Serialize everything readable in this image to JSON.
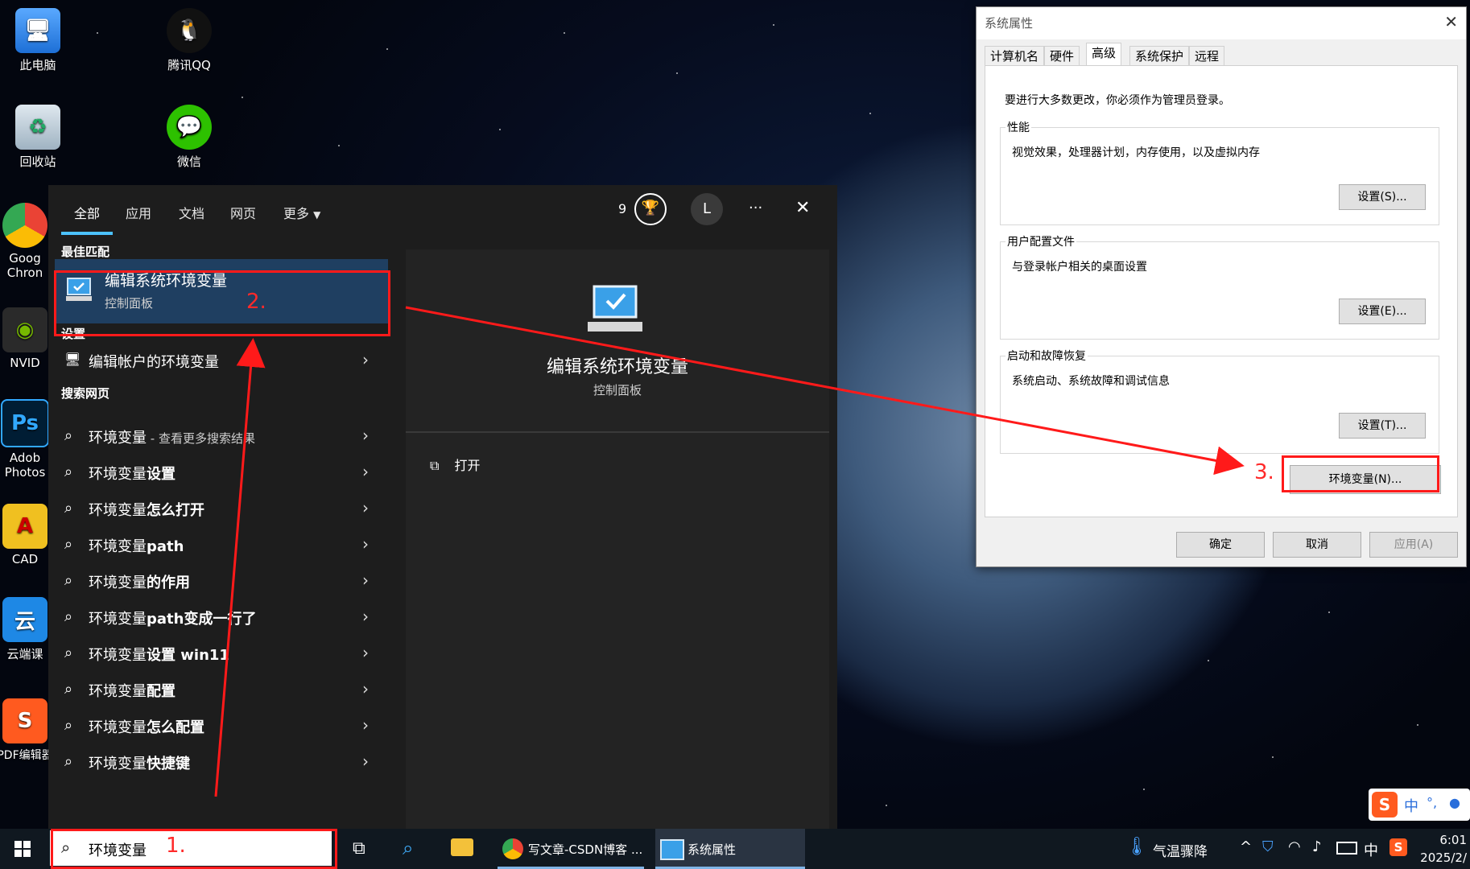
{
  "desktop_icons": {
    "this_pc": "此电脑",
    "qq": "腾讯QQ",
    "recycle_bin": "回收站",
    "wechat": "微信",
    "chrome": "Goog Chron",
    "nvidia": "NVID",
    "photoshop": "Adob Photos",
    "cad": "CAD",
    "yunduan": "云端课",
    "pdf_editor": "PDF编辑器"
  },
  "search_panel": {
    "tabs": [
      "全部",
      "应用",
      "文档",
      "网页",
      "更多"
    ],
    "reward_count": "9",
    "avatar_letter": "L",
    "more_menu": "···",
    "close": "✕",
    "best_match_heading": "最佳匹配",
    "best_match": {
      "title": "编辑系统环境变量",
      "subtitle": "控制面板"
    },
    "settings_heading": "设置",
    "settings_item": "编辑帐户的环境变量",
    "web_heading": "搜索网页",
    "web_results": [
      {
        "prefix": "环境变量",
        "bold": "",
        "suffix": " - 查看更多搜索结果"
      },
      {
        "prefix": "环境变量",
        "bold": "设置",
        "suffix": ""
      },
      {
        "prefix": "环境变量",
        "bold": "怎么打开",
        "suffix": ""
      },
      {
        "prefix": "环境变量",
        "bold": "path",
        "suffix": ""
      },
      {
        "prefix": "环境变量",
        "bold": "的作用",
        "suffix": ""
      },
      {
        "prefix": "环境变量",
        "bold": "path变成一行了",
        "suffix": ""
      },
      {
        "prefix": "环境变量",
        "bold": "设置 win11",
        "suffix": ""
      },
      {
        "prefix": "环境变量",
        "bold": "配置",
        "suffix": ""
      },
      {
        "prefix": "环境变量",
        "bold": "怎么配置",
        "suffix": ""
      },
      {
        "prefix": "环境变量",
        "bold": "快捷键",
        "suffix": ""
      }
    ],
    "preview": {
      "title": "编辑系统环境变量",
      "subtitle": "控制面板",
      "open_action": "打开"
    }
  },
  "system_properties": {
    "title": "系统属性",
    "tabs": [
      "计算机名",
      "硬件",
      "高级",
      "系统保护",
      "远程"
    ],
    "active_tab": "高级",
    "admin_note": "要进行大多数更改，你必须作为管理员登录。",
    "performance": {
      "title": "性能",
      "desc": "视觉效果，处理器计划，内存使用，以及虚拟内存",
      "button": "设置(S)..."
    },
    "user_profiles": {
      "title": "用户配置文件",
      "desc": "与登录帐户相关的桌面设置",
      "button": "设置(E)..."
    },
    "startup_recovery": {
      "title": "启动和故障恢复",
      "desc": "系统启动、系统故障和调试信息",
      "button": "设置(T)..."
    },
    "env_button": "环境变量(N)...",
    "ok": "确定",
    "cancel": "取消",
    "apply": "应用(A)"
  },
  "annotations": {
    "step1": "1.",
    "step2": "2.",
    "step3": "3.",
    "color": "#ff1a1a"
  },
  "taskbar": {
    "search_value": "环境变量",
    "apps": [
      {
        "label": "写文章-CSDN博客 ..."
      },
      {
        "label": "系统属性"
      }
    ],
    "weather": "气温骤降",
    "ime_lang": "中",
    "time": "6:01",
    "date": "2025/2/"
  },
  "ime_toolbar": {
    "lang": "中",
    "punct": "°,",
    "mic": "🎤"
  }
}
